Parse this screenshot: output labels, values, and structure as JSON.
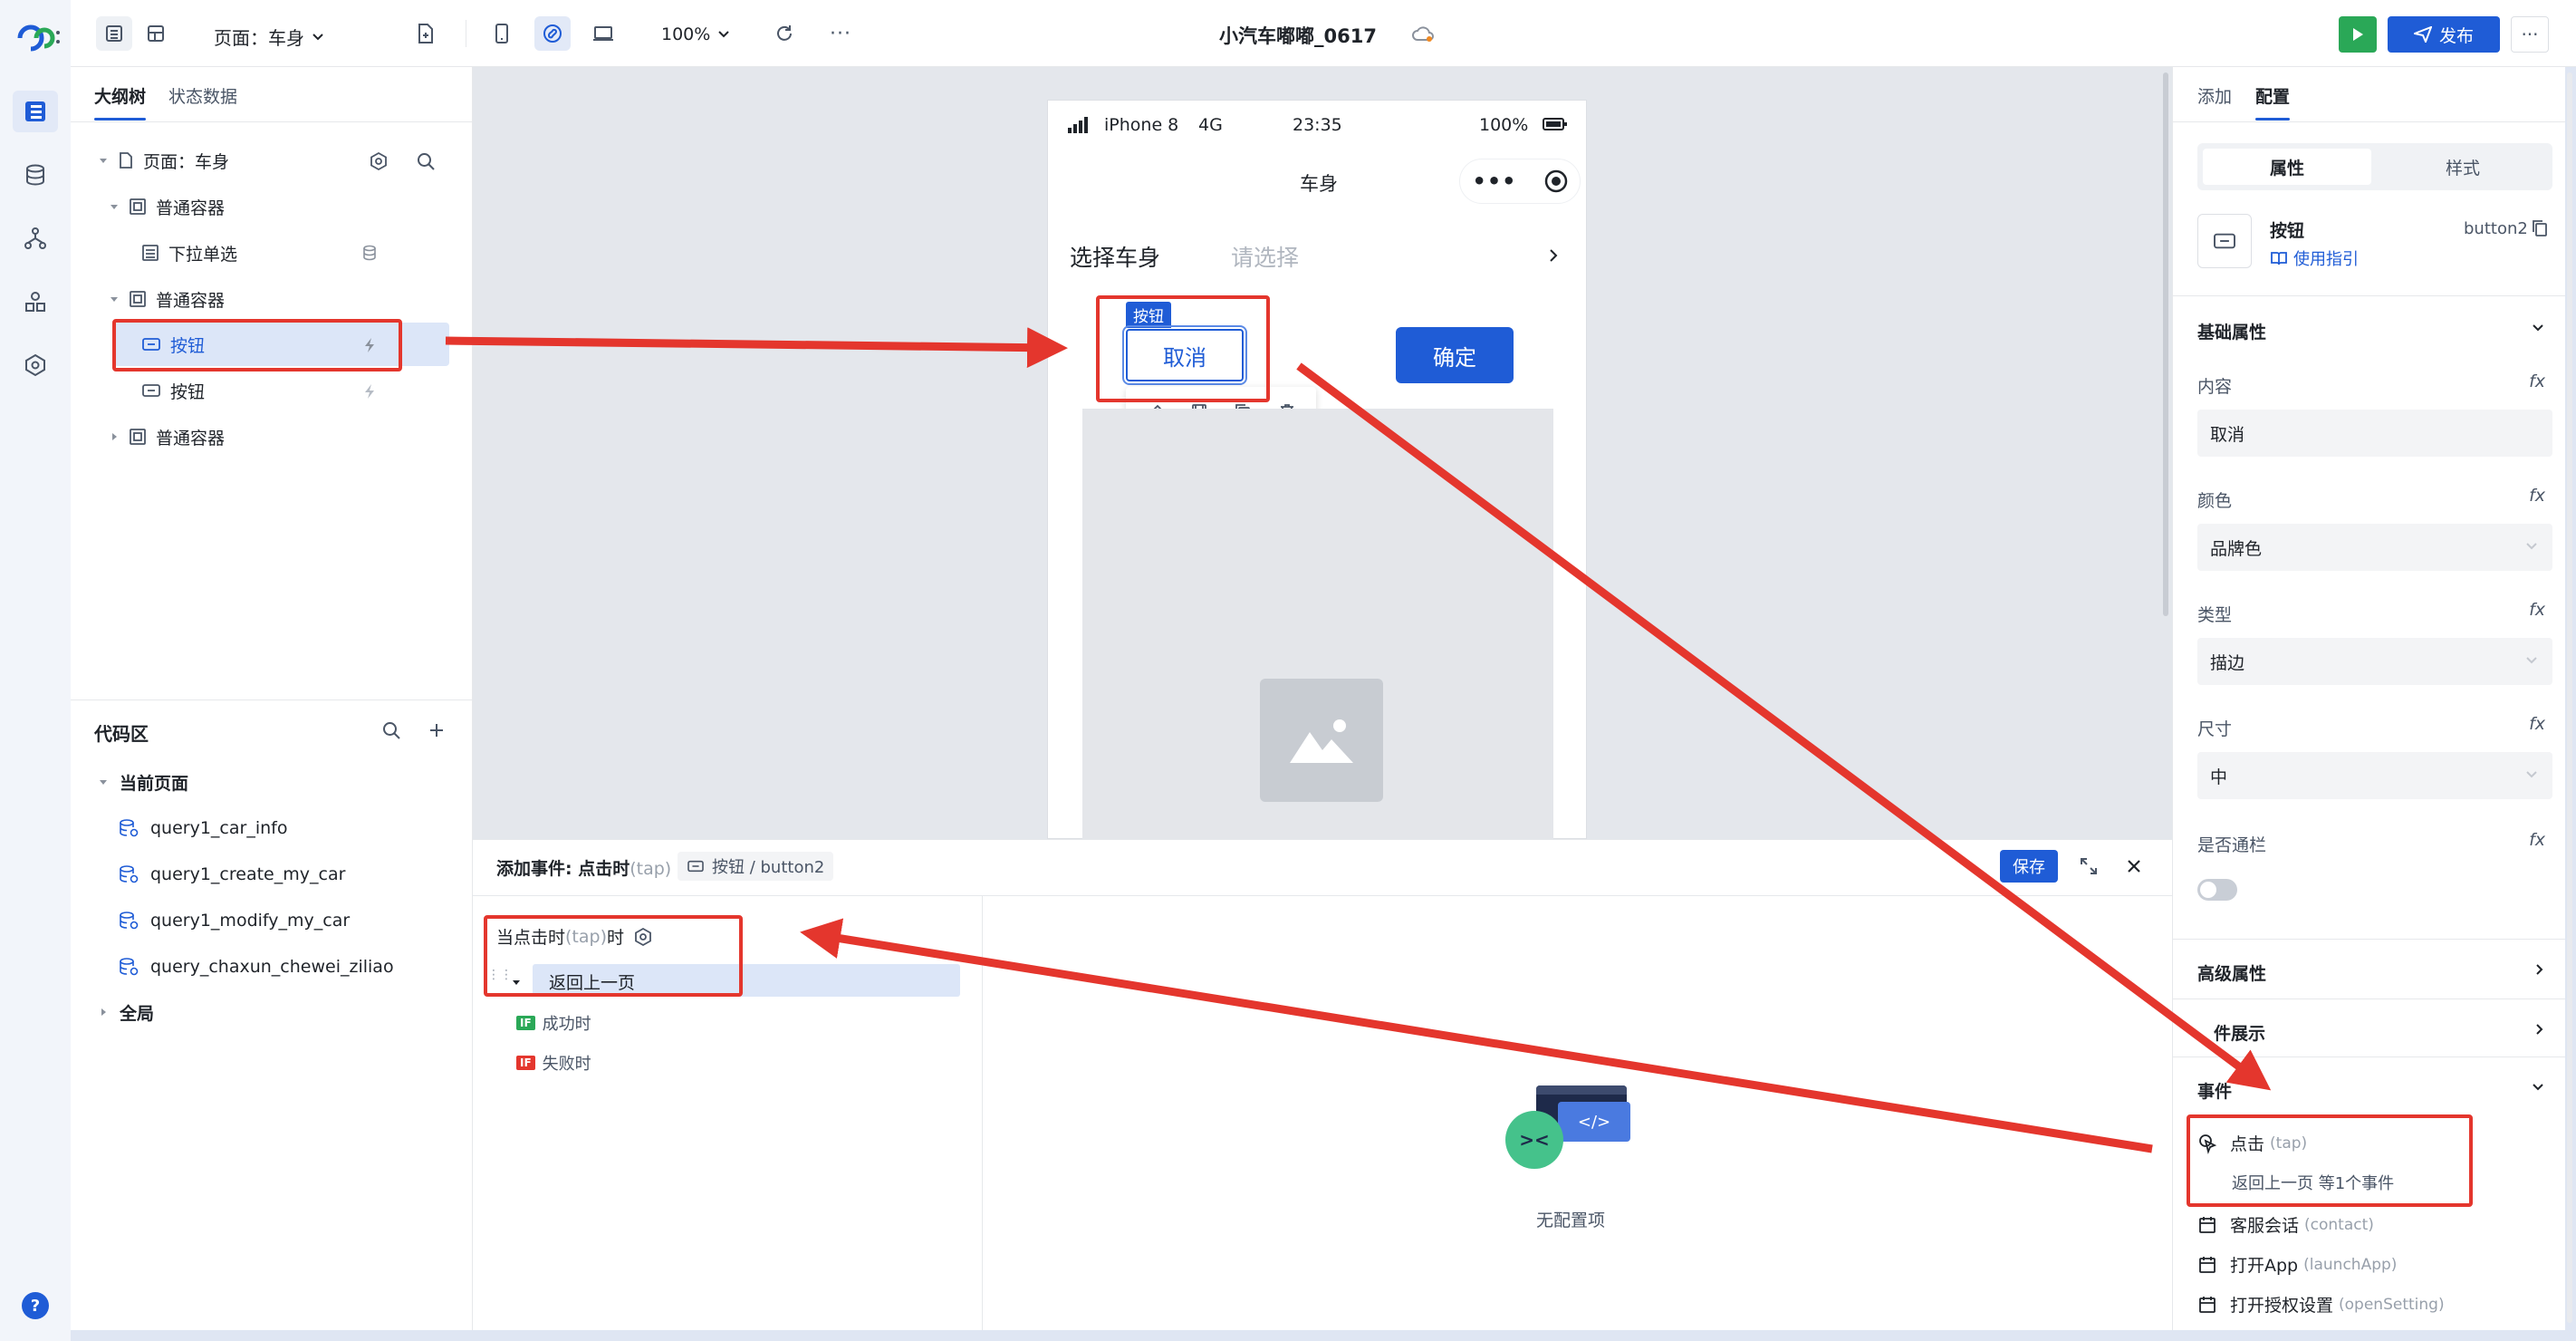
{
  "toolbar": {
    "page_selector": "页面：车身",
    "zoom": "100%",
    "app_title": "小汽车嘟嘟_0617",
    "publish_label": "发布"
  },
  "left_panel": {
    "tabs": [
      "大纲树",
      "状态数据"
    ],
    "tree": {
      "page": "页面：车身",
      "container1": "普通容器",
      "dropdown": "下拉单选",
      "container2": "普通容器",
      "button_selected": "按钮",
      "button2": "按钮",
      "container3": "普通容器"
    },
    "code": {
      "title": "代码区",
      "current_page": "当前页面",
      "queries": [
        "query1_car_info",
        "query1_create_my_car",
        "query1_modify_my_car",
        "query_chaxun_chewei_ziliao"
      ],
      "global": "全局"
    }
  },
  "phone": {
    "carrier": "iPhone 8",
    "network": "4G",
    "time": "23:35",
    "battery": "100%",
    "nav_title": "车身",
    "select_label": "选择车身",
    "select_placeholder": "请选择",
    "component_tag": "按钮",
    "cancel_label": "取消",
    "confirm_label": "确定"
  },
  "event_panel": {
    "title": "添加事件: 点击时",
    "title_suffix": "(tap)",
    "breadcrumb": "按钮 / button2",
    "save_label": "保存",
    "trigger_prefix": "当点击时",
    "trigger_tap": "(tap)",
    "trigger_suffix": "时",
    "action": "返回上一页",
    "if_badge": "IF",
    "success": "成功时",
    "failure": "失败时",
    "empty_text": "无配置项",
    "illustration_text": "</>",
    "illustration_face": "><"
  },
  "right_panel": {
    "tabs": [
      "添加",
      "配置"
    ],
    "segments": [
      "属性",
      "样式"
    ],
    "component_name": "按钮",
    "component_id": "button2",
    "guide_link": "使用指引",
    "basic_props": "基础属性",
    "fx": "fx",
    "content_label": "内容",
    "content_value": "取消",
    "color_label": "颜色",
    "color_value": "品牌色",
    "type_label": "类型",
    "type_value": "描边",
    "size_label": "尺寸",
    "size_value": "中",
    "full_label": "是否通栏",
    "advanced": "高级属性",
    "conditional": "件展示",
    "events": "事件",
    "event_items": [
      {
        "label": "点击",
        "code": "(tap)",
        "sub": "返回上一页 等1个事件"
      },
      {
        "label": "客服会话",
        "code": "(contact)"
      },
      {
        "label": "打开App",
        "code": "(launchApp)"
      },
      {
        "label": "打开授权设置",
        "code": "(openSetting)"
      }
    ]
  },
  "colors": {
    "brand": "#1f5cd6",
    "annotation": "#e4362d",
    "run_button": "#2aa857"
  }
}
